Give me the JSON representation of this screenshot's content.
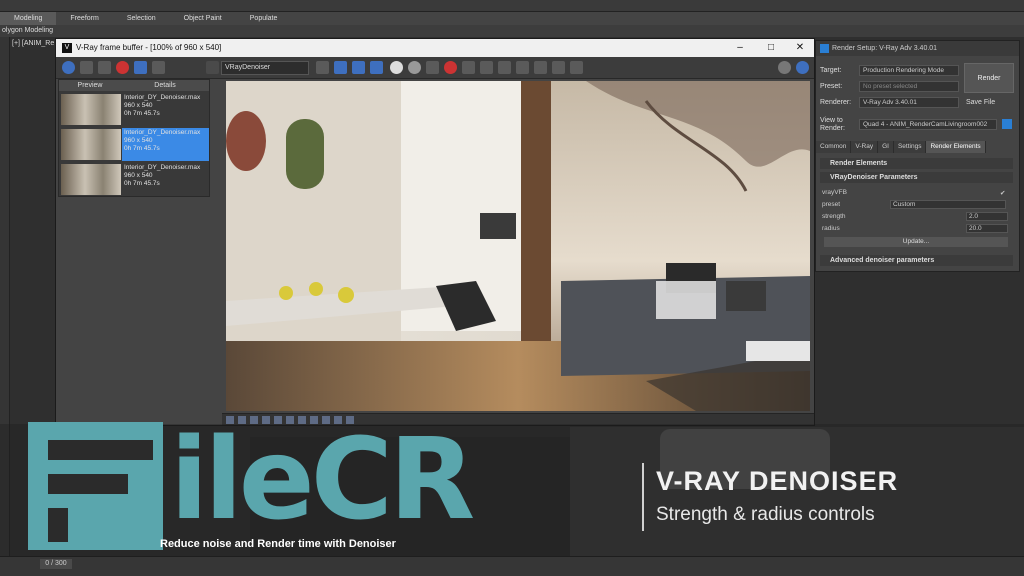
{
  "max": {
    "ribbon_tabs": [
      "Modeling",
      "Freeform",
      "Selection",
      "Object Paint",
      "Populate"
    ],
    "subtitle": "olygon Modeling",
    "viewport_label": "[+] [ANIM_Re",
    "timeline_frame": "0 / 300"
  },
  "frame_buffer": {
    "title": "V-Ray frame buffer - [100% of 960 x 540]",
    "channel": "VRayDenoiser",
    "history_headers": [
      "Preview",
      "Details"
    ],
    "history": [
      {
        "name": "Interior_DY_Denoiser.max",
        "res": "960 x 540",
        "time": "0h 7m 45.7s",
        "selected": false
      },
      {
        "name": "Interior_DY_Denoiser.max",
        "res": "960 x 540",
        "time": "0h 7m 45.7s",
        "selected": true
      },
      {
        "name": "Interior_DY_Denoiser.max",
        "res": "960 x 540",
        "time": "0h 7m 45.7s",
        "selected": false
      }
    ]
  },
  "render_setup": {
    "title": "Render Setup: V-Ray Adv 3.40.01",
    "target_label": "Target:",
    "target_value": "Production Rendering Mode",
    "preset_label": "Preset:",
    "preset_value": "No preset selected",
    "renderer_label": "Renderer:",
    "renderer_value": "V-Ray Adv 3.40.01",
    "save_file": "Save File",
    "view_label": "View to Render:",
    "view_value": "Quad 4 - ANIM_RenderCamLivingroom002",
    "render_button": "Render",
    "tabs": [
      "Common",
      "V-Ray",
      "GI",
      "Settings",
      "Render Elements"
    ],
    "rollout_elements": "Render Elements",
    "rollout_denoiser": "VRayDenoiser Parameters",
    "param_vfb": "vrayVFB",
    "param_preset": "preset",
    "preset_value2": "Custom",
    "param_strength": "strength",
    "strength_value": "2.0",
    "param_radius": "radius",
    "radius_value": "20.0",
    "update_button": "Update...",
    "rollout_advanced": "Advanced denoiser parameters"
  },
  "watermark": {
    "logo_text": "ileCR",
    "title": "V-RAY DENOISER",
    "subtitle": "Strength & radius controls",
    "caption": "Reduce noise and Render time with Denoiser"
  }
}
